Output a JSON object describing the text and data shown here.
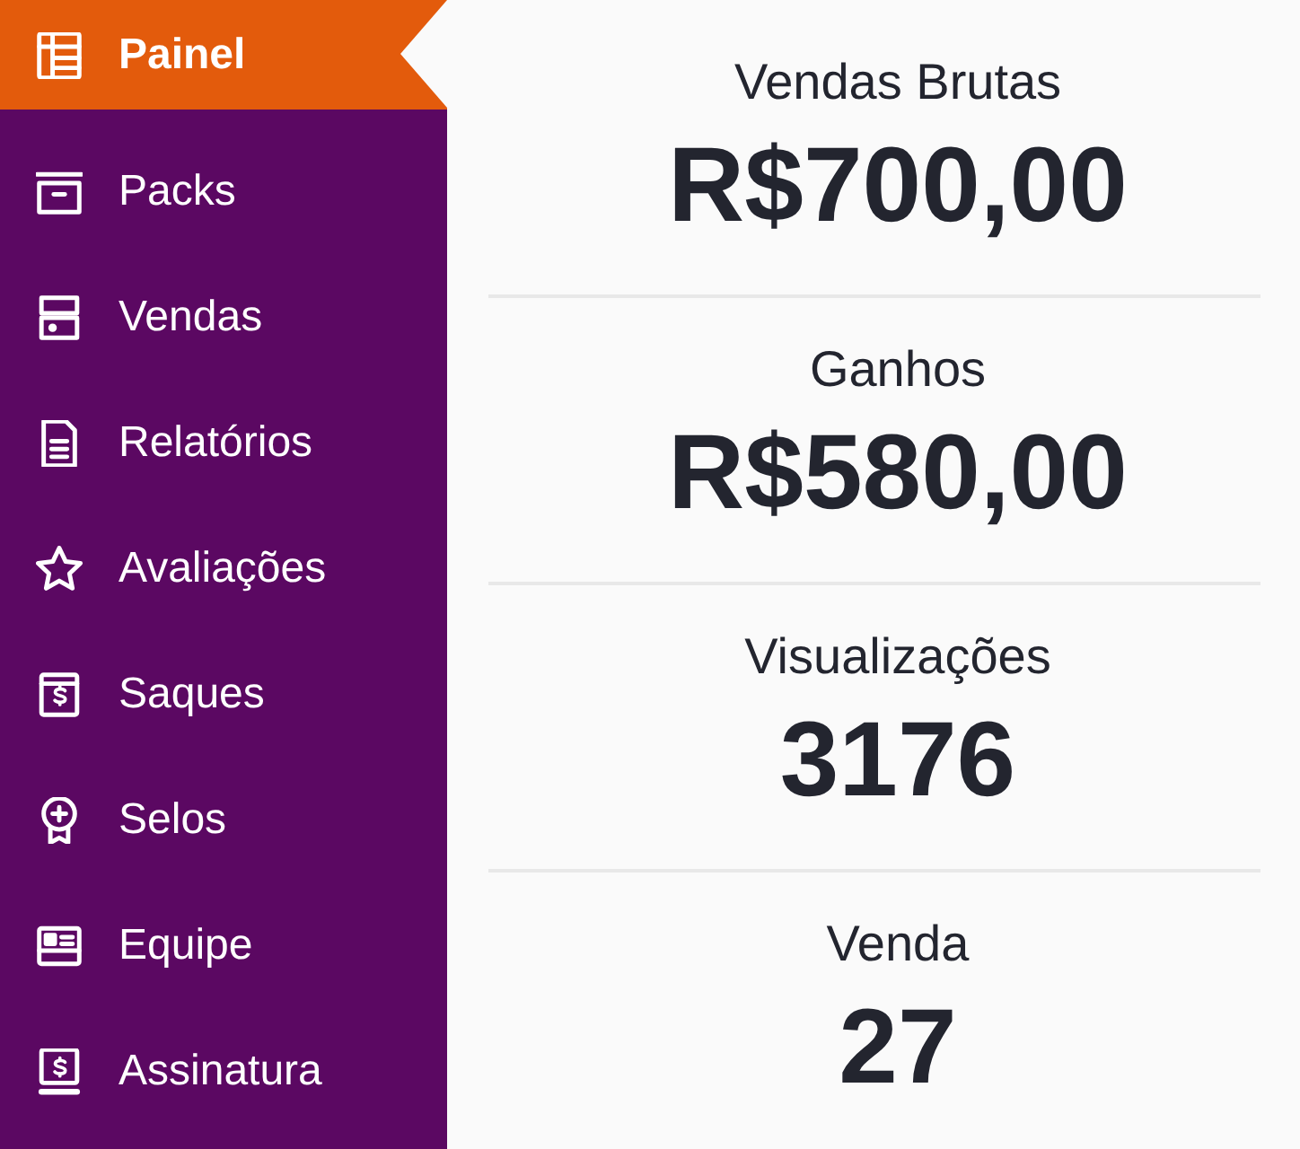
{
  "sidebar": {
    "items": [
      {
        "label": "Painel",
        "selected": true
      },
      {
        "label": "Packs",
        "selected": false
      },
      {
        "label": "Vendas",
        "selected": false
      },
      {
        "label": "Relatórios",
        "selected": false
      },
      {
        "label": "Avaliações",
        "selected": false
      },
      {
        "label": "Saques",
        "selected": false
      },
      {
        "label": "Selos",
        "selected": false
      },
      {
        "label": "Equipe",
        "selected": false
      },
      {
        "label": "Assinatura",
        "selected": false
      }
    ]
  },
  "stats": [
    {
      "label": "Vendas Brutas",
      "value": "R$700,00"
    },
    {
      "label": "Ganhos",
      "value": "R$580,00"
    },
    {
      "label": "Visualizações",
      "value": "3176"
    },
    {
      "label": "Venda",
      "value": "27"
    }
  ]
}
